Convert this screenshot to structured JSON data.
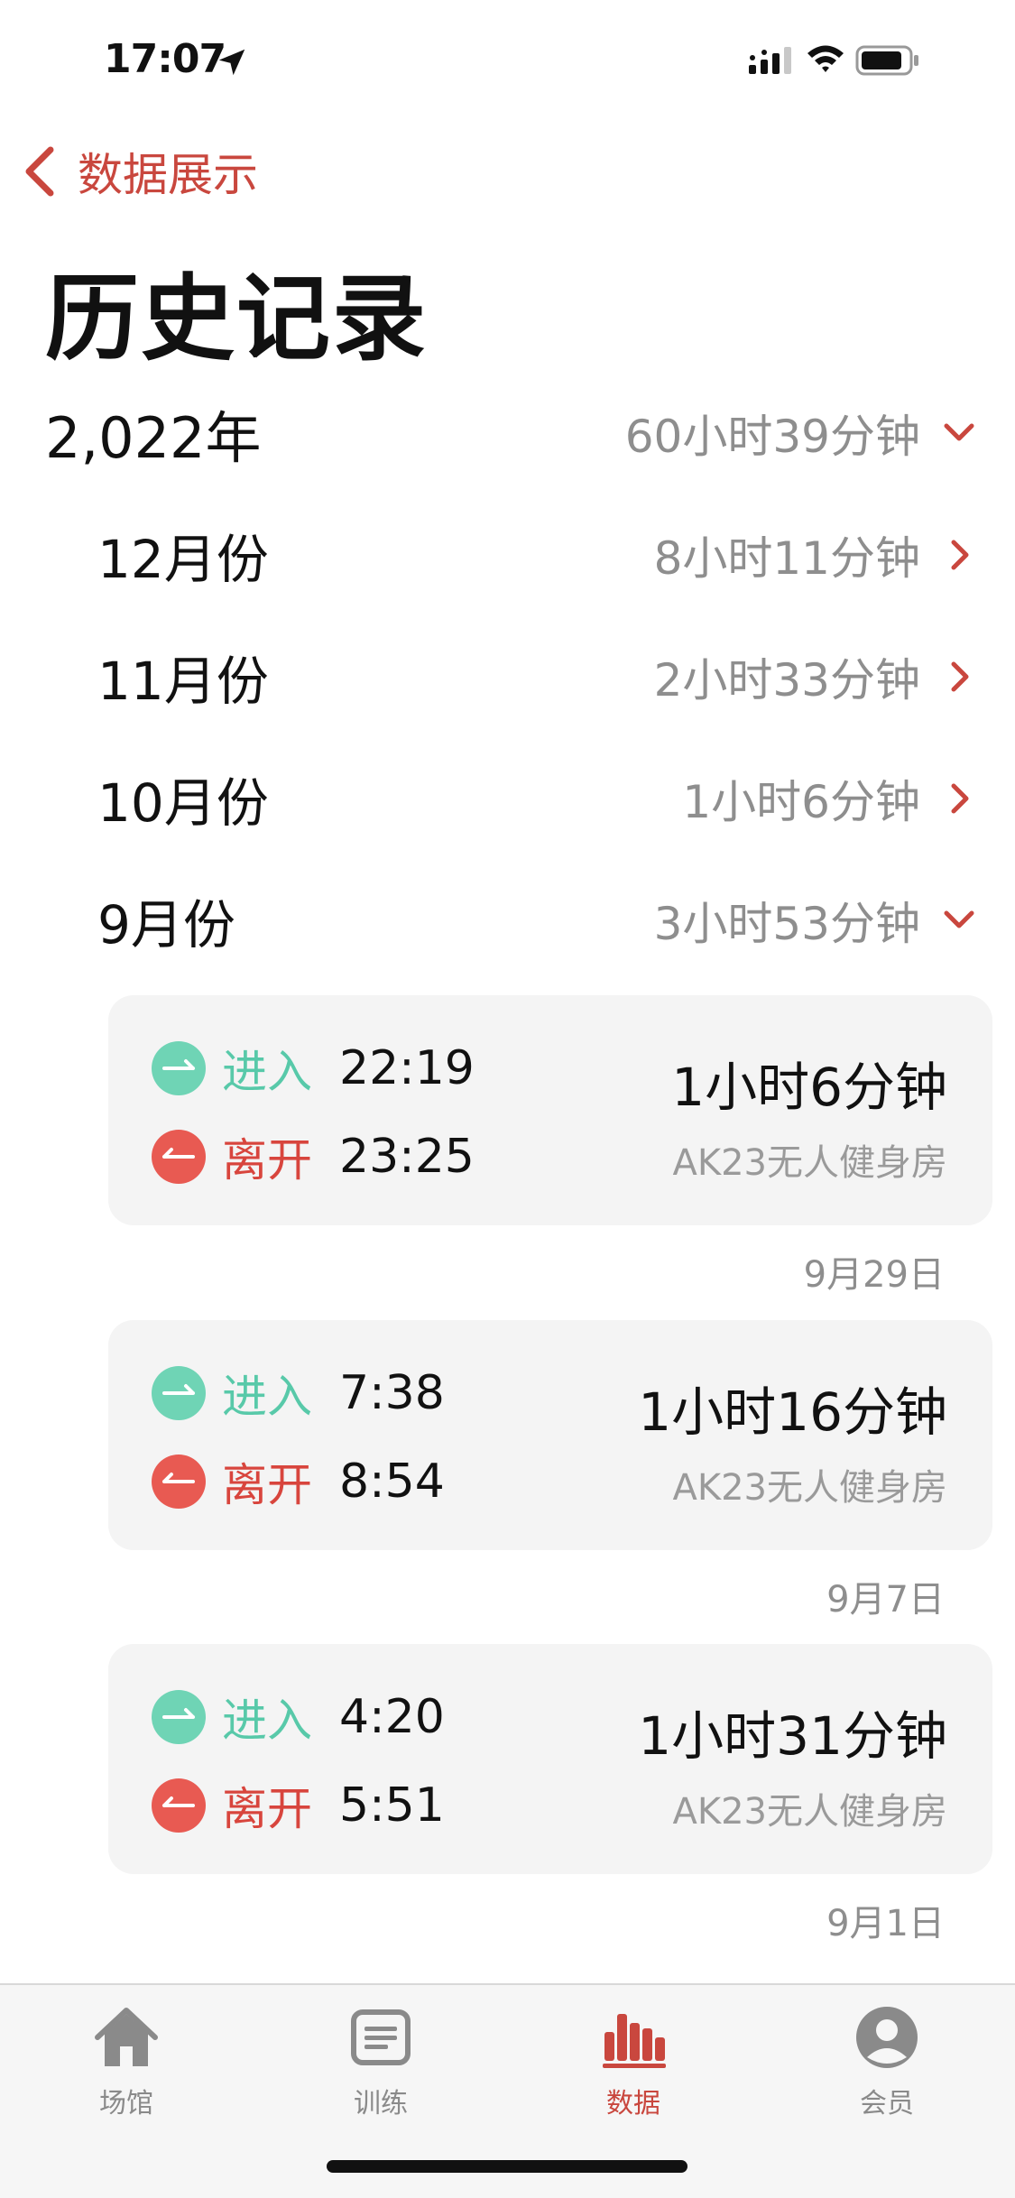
{
  "status_bar": {
    "time": "17:07"
  },
  "nav": {
    "back_label": "数据展示",
    "title": "历史记录"
  },
  "year": {
    "label": "2,022年",
    "total": "60小时39分钟",
    "expanded": true
  },
  "months": [
    {
      "label": "12月份",
      "total": "8小时11分钟",
      "expanded": false
    },
    {
      "label": "11月份",
      "total": "2小时33分钟",
      "expanded": false
    },
    {
      "label": "10月份",
      "total": "1小时6分钟",
      "expanded": false
    },
    {
      "label": "9月份",
      "total": "3小时53分钟",
      "expanded": true
    }
  ],
  "records": [
    {
      "enter_label": "进入",
      "enter_time": "22:19",
      "leave_label": "离开",
      "leave_time": "23:25",
      "duration": "1小时6分钟",
      "venue": "AK23无人健身房",
      "date": "9月29日"
    },
    {
      "enter_label": "进入",
      "enter_time": "7:38",
      "leave_label": "离开",
      "leave_time": "8:54",
      "duration": "1小时16分钟",
      "venue": "AK23无人健身房",
      "date": "9月7日"
    },
    {
      "enter_label": "进入",
      "enter_time": "4:20",
      "leave_label": "离开",
      "leave_time": "5:51",
      "duration": "1小时31分钟",
      "venue": "AK23无人健身房",
      "date": "9月1日"
    }
  ],
  "tabs": [
    {
      "label": "场馆",
      "icon": "house-icon",
      "active": false
    },
    {
      "label": "训练",
      "icon": "list-icon",
      "active": false
    },
    {
      "label": "数据",
      "icon": "bar-chart-icon",
      "active": true
    },
    {
      "label": "会员",
      "icon": "person-icon",
      "active": false
    }
  ],
  "colors": {
    "accent": "#c9473e",
    "enter": "#6fd4b5",
    "leave": "#e85a52",
    "secondary_text": "#8e8e8e"
  }
}
